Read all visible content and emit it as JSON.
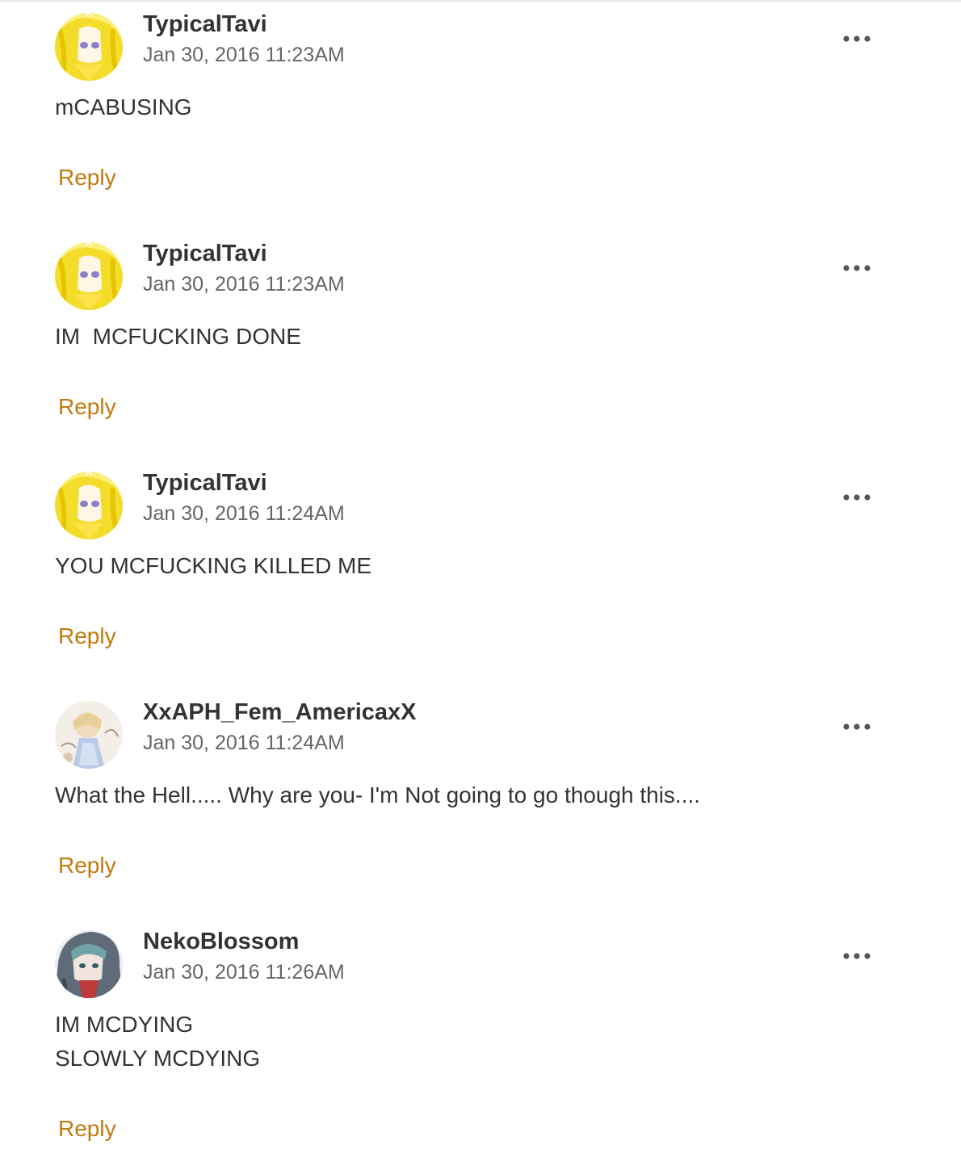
{
  "colors": {
    "reply_accent": "#c27a0e",
    "username": "#333333",
    "timestamp": "#666666",
    "body": "#333333"
  },
  "comments": [
    {
      "username": "TypicalTavi",
      "timestamp": "Jan 30, 2016 11:23AM",
      "lines": [
        "mCABUSING"
      ],
      "reply_label": "Reply",
      "avatar_icon": "anime-girl-yellow-avatar"
    },
    {
      "username": "TypicalTavi",
      "timestamp": "Jan 30, 2016 11:23AM",
      "lines": [
        "IM  MCFUCKING DONE"
      ],
      "reply_label": "Reply",
      "avatar_icon": "anime-girl-yellow-avatar"
    },
    {
      "username": "TypicalTavi",
      "timestamp": "Jan 30, 2016 11:24AM",
      "lines": [
        "YOU MCFUCKING KILLED ME"
      ],
      "reply_label": "Reply",
      "avatar_icon": "anime-girl-yellow-avatar"
    },
    {
      "username": "XxAPH_Fem_AmericaxX",
      "timestamp": "Jan 30, 2016 11:24AM",
      "lines": [
        "What the Hell..... Why are you- I'm Not going to go though this...."
      ],
      "reply_label": "Reply",
      "avatar_icon": "anime-sketch-avatar"
    },
    {
      "username": "NekoBlossom",
      "timestamp": "Jan 30, 2016 11:26AM",
      "lines": [
        "IM MCDYING",
        "SLOWLY MCDYING"
      ],
      "reply_label": "Reply",
      "avatar_icon": "anime-hooded-girl-avatar"
    }
  ]
}
